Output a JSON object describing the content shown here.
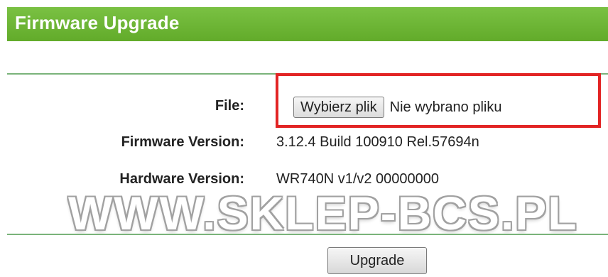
{
  "header": {
    "title": "Firmware Upgrade"
  },
  "form": {
    "file_label": "File:",
    "choose_file_button": "Wybierz plik",
    "no_file_text": "Nie wybrano pliku",
    "firmware_label": "Firmware Version:",
    "firmware_value": "3.12.4 Build 100910 Rel.57694n",
    "hardware_label": "Hardware Version:",
    "hardware_value": "WR740N v1/v2 00000000",
    "upgrade_button": "Upgrade"
  },
  "watermark": {
    "text": "WWW.SKLEP-BCS.PL"
  },
  "colors": {
    "header_green": "#6ab533",
    "divider_green": "#7ab37a",
    "highlight_red": "#e22424"
  }
}
